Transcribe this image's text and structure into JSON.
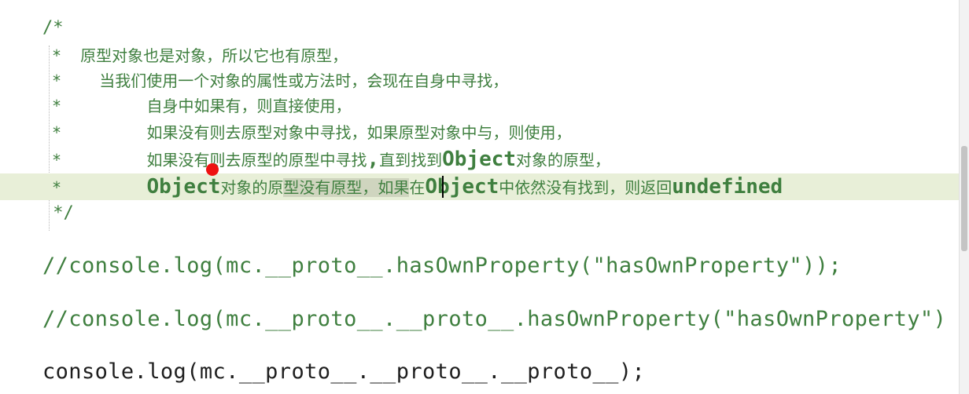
{
  "editor": {
    "comment_block": {
      "open": "/*",
      "l1": " *  原型对象也是对象，所以它也有原型，",
      "l2": " *    当我们使用一个对象的属性或方法时，会现在自身中寻找，",
      "l3_prefix": " *         ",
      "l3_text": "自身中如果有，则直接使用，",
      "l4_prefix": " *         ",
      "l4_text": "如果没有则去原型对象中寻找，如果原型对象中与，则使用，",
      "l5_prefix": " *         ",
      "l5_text_a": "如果没有则去原型的原型中寻找",
      "l5_ascii_a": ",",
      "l5_text_b": "直到找到",
      "l5_ascii_b": "Object",
      "l5_text_c": "对象的原型，",
      "l6_prefix": " *         ",
      "l6_ascii_a": "Object",
      "l6_text_a": "对象的原",
      "l6_sel": "型没有原型，如果",
      "l6_text_b": "在",
      "l6_ascii_b": "Object",
      "l6_text_c": "中依然没有找到，则返回",
      "l6_ascii_c": "undefined",
      "close": " */"
    },
    "code_lines": {
      "line1": "//console.log(mc.__proto__.hasOwnProperty(\"hasOwnProperty\"));",
      "line2": "//console.log(mc.__proto__.__proto__.hasOwnProperty(\"hasOwnProperty\")",
      "line3": "console.log(mc.__proto__.__proto__.__proto__);"
    }
  },
  "colors": {
    "comment": "#3f7f3f",
    "code": "#1e1e1e",
    "current_line": "#e8efd8",
    "selection": "#cfd5bf",
    "cursor_marker": "#ee1111"
  }
}
